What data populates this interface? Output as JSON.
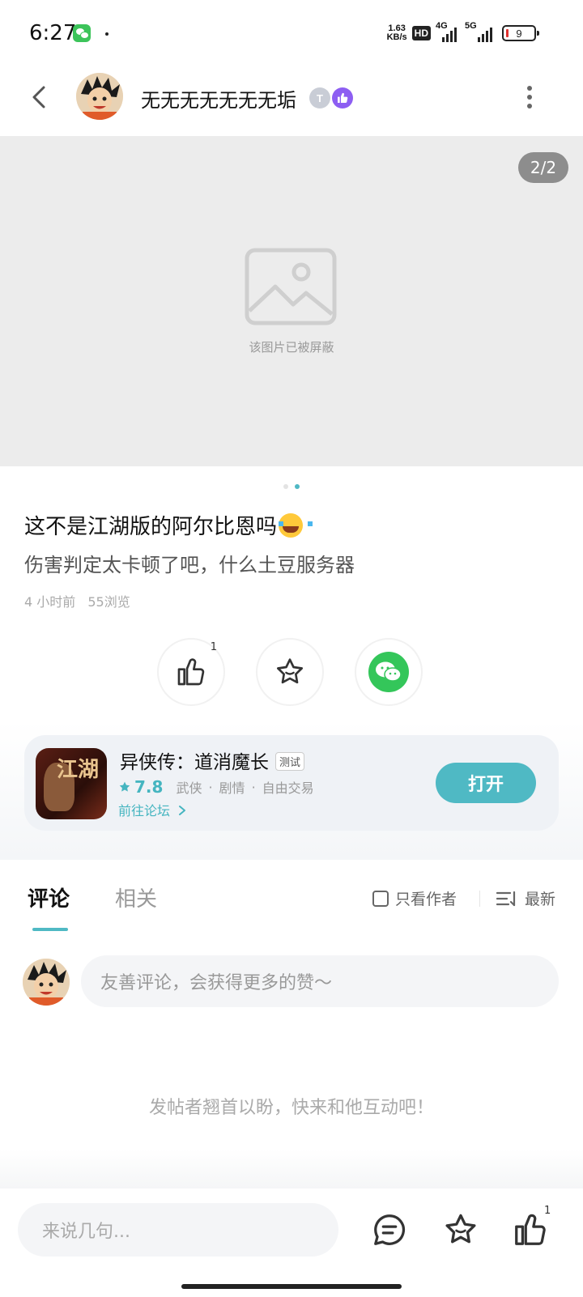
{
  "status_bar": {
    "time": "6:27",
    "net_speed_value": "1.63",
    "net_speed_unit": "KB/s",
    "hd_label": "HD",
    "net_4g": "4G",
    "net_5g": "5G",
    "battery": "9"
  },
  "header": {
    "author_name": "无无无无无无无垢",
    "badge_label": "T"
  },
  "image": {
    "page_indicator": "2/2",
    "blocked_text": "该图片已被屏蔽"
  },
  "post": {
    "title": "这不是江湖版的阿尔比恩吗",
    "body": "伤害判定太卡顿了吧，什么土豆服务器",
    "time_ago": "4 小时前",
    "views": "55浏览",
    "like_count": "1"
  },
  "game": {
    "icon_text": "江湖",
    "title": "异侠传：道消魔长",
    "tag": "测试",
    "rating": "7.8",
    "genres": [
      "武侠",
      "剧情",
      "自由交易"
    ],
    "forum_link": "前往论坛",
    "open_button": "打开"
  },
  "tabs": {
    "comment": "评论",
    "related": "相关",
    "author_only": "只看作者",
    "sort": "最新"
  },
  "comment": {
    "placeholder": "友善评论，会获得更多的赞～",
    "empty_text": "发帖者翘首以盼，快来和他互动吧！"
  },
  "bottom_bar": {
    "input_placeholder": "来说几句...",
    "like_count": "1"
  },
  "colors": {
    "accent": "#4fb9c4",
    "wechat_green": "#34c65a",
    "badge_purple": "#8d5ef2"
  }
}
